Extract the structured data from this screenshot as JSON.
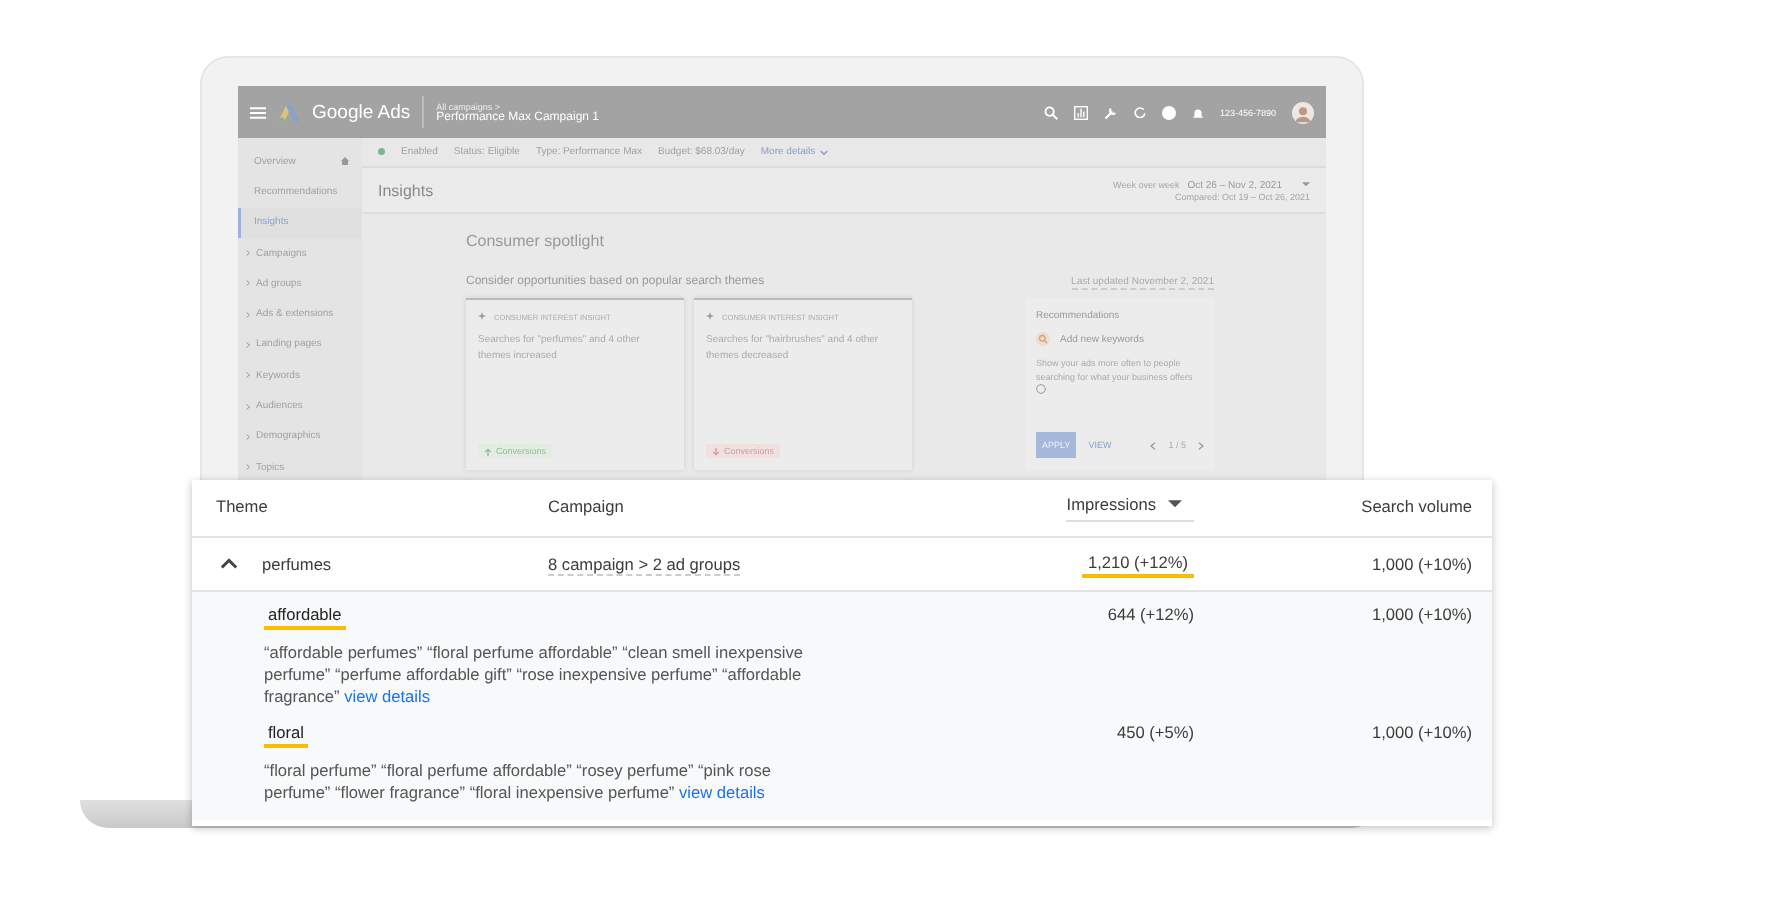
{
  "header": {
    "product": "Google Ads",
    "breadcrumb": "All campaigns >",
    "campaign": "Performance Max Campaign 1",
    "phone": "123-456-7890"
  },
  "sidebar": {
    "items": [
      {
        "label": "Overview",
        "kind": "home",
        "selected": false
      },
      {
        "label": "Recommendations",
        "kind": "page",
        "selected": false
      },
      {
        "label": "Insights",
        "kind": "page",
        "selected": true
      },
      {
        "label": "Campaigns",
        "kind": "group",
        "selected": false
      },
      {
        "label": "Ad groups",
        "kind": "group",
        "selected": false
      },
      {
        "label": "Ads & extensions",
        "kind": "group",
        "selected": false
      },
      {
        "label": "Landing pages",
        "kind": "group",
        "selected": false
      },
      {
        "label": "Keywords",
        "kind": "group",
        "selected": false
      },
      {
        "label": "Audiences",
        "kind": "group",
        "selected": false
      },
      {
        "label": "Demographics",
        "kind": "group",
        "selected": false
      },
      {
        "label": "Topics",
        "kind": "group",
        "selected": false
      }
    ]
  },
  "status": {
    "enabled": "Enabled",
    "items": [
      "Status: Eligible",
      "Type: Performance Max",
      "Budget: $68.03/day"
    ],
    "more": "More details"
  },
  "page": {
    "title": "Insights",
    "range_label": "Week over week",
    "range": "Oct 26 – Nov 2, 2021",
    "compared": "Compared: Oct 19 – Oct 26, 2021"
  },
  "spotlight": {
    "title": "Consumer spotlight",
    "subtitle": "Consider opportunities based on popular search themes",
    "updated": "Last updated November 2, 2021",
    "insights": [
      {
        "label": "CONSUMER INTEREST INSIGHT",
        "text": "Searches for \"perfumes\" and 4 other themes increased",
        "chip": "Conversions",
        "increased": true
      },
      {
        "label": "CONSUMER INTEREST INSIGHT",
        "text": "Searches for \"hairbrushes\" and 4 other themes decreased",
        "chip": "Conversions",
        "increased": false
      }
    ]
  },
  "recommendations": {
    "title": "Recommendations",
    "item": "Add new keywords",
    "text": "Show your ads more often to people searching for what your business offers",
    "apply": "APPLY",
    "view": "VIEW",
    "pager": "1 / 5"
  },
  "table": {
    "columns": [
      {
        "label": "Theme",
        "sorted": false
      },
      {
        "label": "Campaign",
        "sorted": false
      },
      {
        "label": "Impressions",
        "sorted": true
      },
      {
        "label": "Search volume",
        "sorted": false
      }
    ],
    "rows": [
      {
        "theme": "perfumes",
        "expanded": true,
        "campaign": "8 campaign > 2 ad groups",
        "impressions": "1,210 (+12%)",
        "highlighted": true,
        "search_volume": "1,000 (+10%)",
        "children": [
          {
            "theme": "affordable",
            "highlighted": true,
            "searches": "“affordable perfumes” “floral perfume affordable” “clean smell inexpensive perfume” “perfume affordable gift” “rose inexpensive perfume” “affordable fragrance”",
            "link": "view details",
            "impressions": "644 (+12%)",
            "search_volume": "1,000 (+10%)"
          },
          {
            "theme": "floral",
            "highlighted": true,
            "searches": "“floral perfume” “floral perfume affordable” “rosey perfume” “pink rose perfume” “flower fragrance” “floral inexpensive perfume”",
            "link": "view details",
            "impressions": "450 (+5%)",
            "search_volume": "1,000 (+10%)"
          }
        ]
      }
    ]
  }
}
